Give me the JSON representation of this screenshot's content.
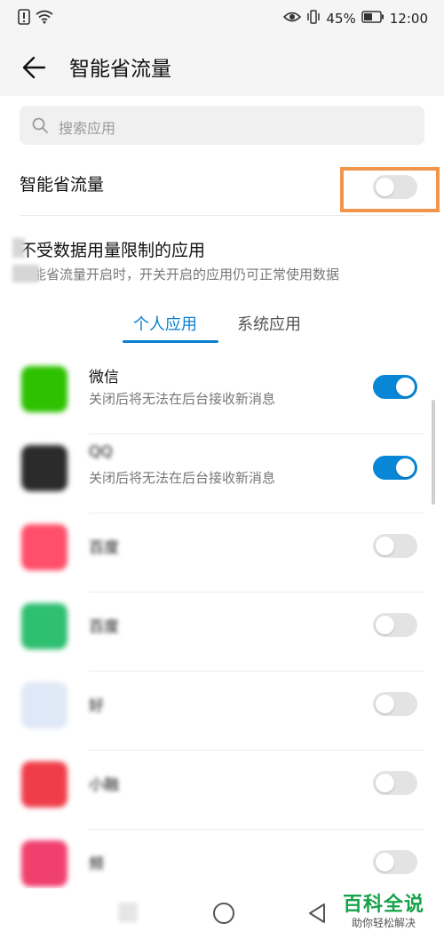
{
  "status_bar": {
    "battery": "45%",
    "time": "12:00"
  },
  "header": {
    "title": "智能省流量"
  },
  "search": {
    "placeholder": "搜索应用"
  },
  "main_toggle": {
    "label": "智能省流量",
    "state": "off"
  },
  "section": {
    "title": "不受数据用量限制的应用",
    "subtitle": "智能省流量开启时，开关开启的应用仍可正常使用数据"
  },
  "tabs": [
    {
      "label": "个人应用",
      "active": true
    },
    {
      "label": "系统应用",
      "active": false
    }
  ],
  "apps": [
    {
      "name": "微信",
      "desc": "关闭后将无法在后台接收新消息",
      "toggle": "on",
      "icon_color": "#2dc100"
    },
    {
      "name": "QQ",
      "desc": "关闭后将无法在后台接收新消息",
      "toggle": "on",
      "icon_color": "#2b2b2b"
    },
    {
      "name": "百度",
      "desc": "",
      "toggle": "off",
      "icon_color": "#ff4f6a"
    },
    {
      "name": "百度",
      "desc": "",
      "toggle": "off",
      "icon_color": "#2fbf71"
    },
    {
      "name": "好",
      "desc": "",
      "toggle": "off",
      "icon_color": "#dfe8f6"
    },
    {
      "name": "小融",
      "desc": "",
      "toggle": "off",
      "icon_color": "#ef3e4a"
    },
    {
      "name": "频",
      "desc": "",
      "toggle": "off",
      "icon_color": "#f0406e"
    }
  ],
  "watermark": {
    "main": "百科全说",
    "sub": "助你轻松解决"
  },
  "colors": {
    "accent": "#0a7fd0",
    "highlight_box": "#f0954a",
    "toggle_on": "#0a86d6"
  }
}
